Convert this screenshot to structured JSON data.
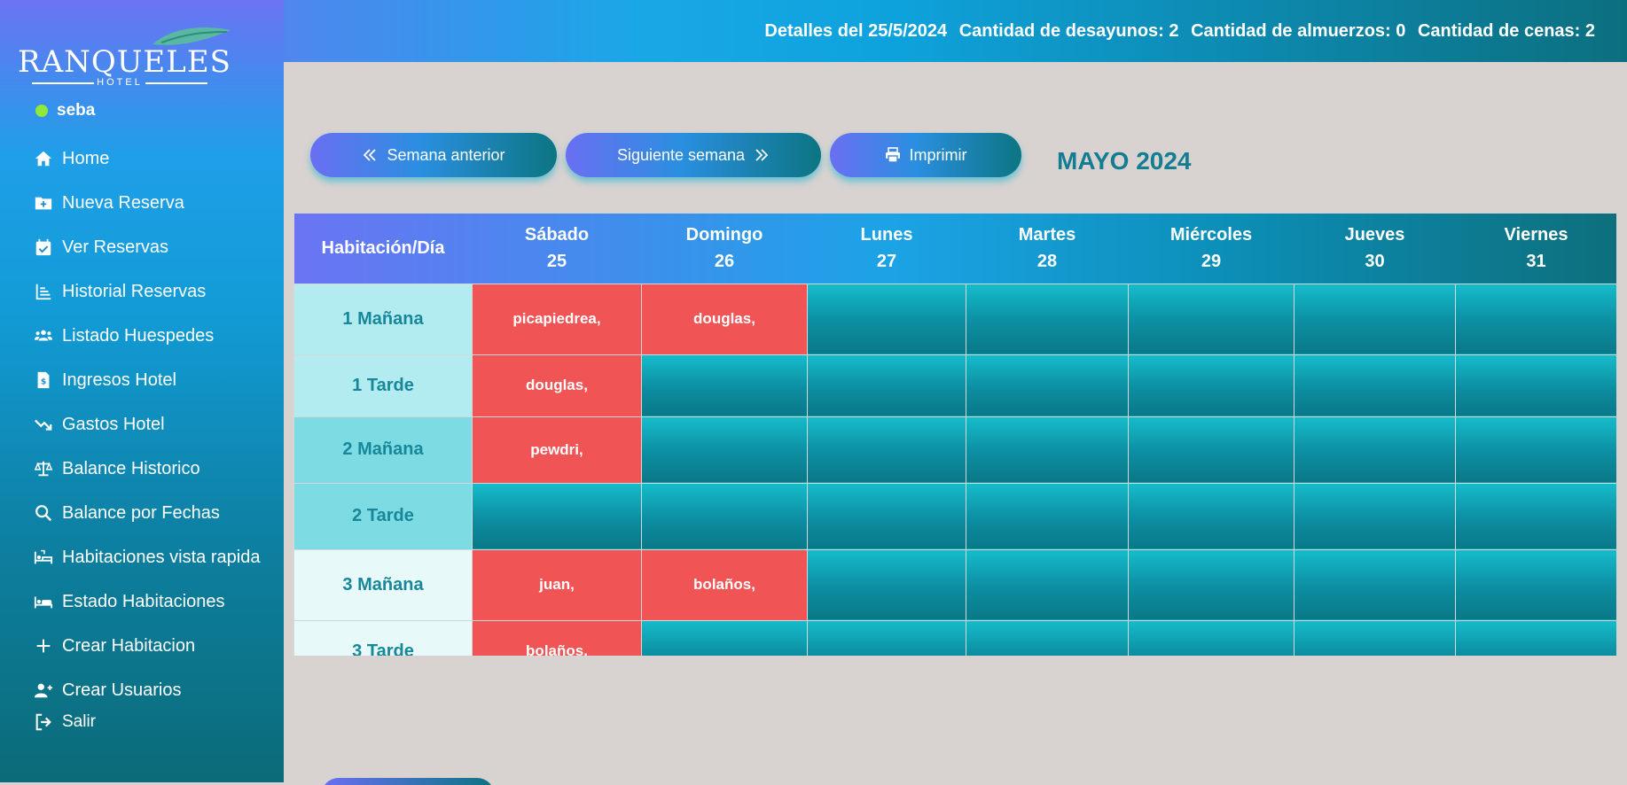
{
  "header": {
    "details_date": "Detalles del 25/5/2024",
    "breakfasts": "Cantidad de desayunos: 2",
    "lunches": "Cantidad de almuerzos: 0",
    "dinners": "Cantidad de cenas: 2"
  },
  "sidebar": {
    "logo_text": "RANQUELES",
    "logo_sub": "HOTEL",
    "user": "seba",
    "items": [
      {
        "label": "Home",
        "icon": "home-icon"
      },
      {
        "label": "Nueva Reserva",
        "icon": "folder-plus-icon"
      },
      {
        "label": "Ver Reservas",
        "icon": "calendar-check-icon"
      },
      {
        "label": "Historial Reservas",
        "icon": "list-icon"
      },
      {
        "label": "Listado Huespedes",
        "icon": "users-icon"
      },
      {
        "label": "Ingresos Hotel",
        "icon": "invoice-dollar-icon"
      },
      {
        "label": "Gastos Hotel",
        "icon": "trend-down-icon"
      },
      {
        "label": "Balance Historico",
        "icon": "scale-icon"
      },
      {
        "label": "Balance por Fechas",
        "icon": "search-icon"
      },
      {
        "label": "Habitaciones vista rapida",
        "icon": "hotel-bed-icon"
      },
      {
        "label": "Estado Habitaciones",
        "icon": "bed-icon"
      },
      {
        "label": "Crear Habitacion",
        "icon": "plus-icon"
      },
      {
        "label": "Crear Usuarios",
        "icon": "user-plus-icon"
      },
      {
        "label": "Salir",
        "icon": "logout-icon"
      }
    ]
  },
  "controls": {
    "prev_week": "Semana anterior",
    "next_week": "Siguiente semana",
    "print": "Imprimir",
    "month_title": "MAYO 2024"
  },
  "calendar": {
    "corner_header": "Habitación/Día",
    "days": [
      {
        "name": "Sábado",
        "num": "25"
      },
      {
        "name": "Domingo",
        "num": "26"
      },
      {
        "name": "Lunes",
        "num": "27"
      },
      {
        "name": "Martes",
        "num": "28"
      },
      {
        "name": "Miércoles",
        "num": "29"
      },
      {
        "name": "Jueves",
        "num": "30"
      },
      {
        "name": "Viernes",
        "num": "31"
      }
    ],
    "rows": [
      {
        "room": "1 Mañana",
        "cells": [
          "picapiedrea,",
          "douglas,",
          "",
          "",
          "",
          "",
          ""
        ]
      },
      {
        "room": "1 Tarde",
        "cells": [
          "douglas,",
          "",
          "",
          "",
          "",
          "",
          ""
        ]
      },
      {
        "room": "2 Mañana",
        "cells": [
          "pewdri,",
          "",
          "",
          "",
          "",
          "",
          ""
        ]
      },
      {
        "room": "2 Tarde",
        "cells": [
          "",
          "",
          "",
          "",
          "",
          "",
          ""
        ]
      },
      {
        "room": "3 Mañana",
        "cells": [
          "juan,",
          "bolaños,",
          "",
          "",
          "",
          "",
          ""
        ]
      },
      {
        "room": "3 Tarde",
        "cells": [
          "bolaños,",
          "",
          "",
          "",
          "",
          "",
          ""
        ]
      }
    ]
  },
  "colors": {
    "booked": "#f05454",
    "accent": "#137d92"
  }
}
